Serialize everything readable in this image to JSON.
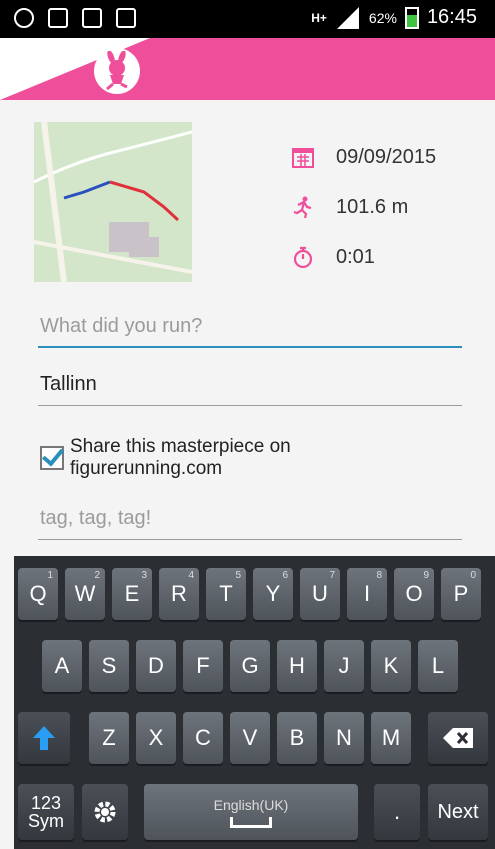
{
  "status_bar": {
    "battery": "62%",
    "time": "16:45",
    "network": "H+"
  },
  "run": {
    "date": "09/09/2015",
    "distance": "101.6 m",
    "duration": "0:01"
  },
  "form": {
    "name_placeholder": "What did you run?",
    "location_value": "Tallinn",
    "share_label": "Share this masterpiece on figurerunning.com",
    "share_checked": true,
    "tags_placeholder": "tag, tag, tag!"
  },
  "keyboard": {
    "row1": [
      "Q",
      "W",
      "E",
      "R",
      "T",
      "Y",
      "U",
      "I",
      "O",
      "P"
    ],
    "row1_nums": [
      "1",
      "2",
      "3",
      "4",
      "5",
      "6",
      "7",
      "8",
      "9",
      "0"
    ],
    "row2": [
      "A",
      "S",
      "D",
      "F",
      "G",
      "H",
      "J",
      "K",
      "L"
    ],
    "row3": [
      "Z",
      "X",
      "C",
      "V",
      "B",
      "N",
      "M"
    ],
    "sym_label": "123\nSym",
    "space_label": "English(UK)",
    "period": ".",
    "next_label": "Next"
  },
  "colors": {
    "brand_pink": "#ef4f9a",
    "accent_blue": "#2a8fbd"
  }
}
